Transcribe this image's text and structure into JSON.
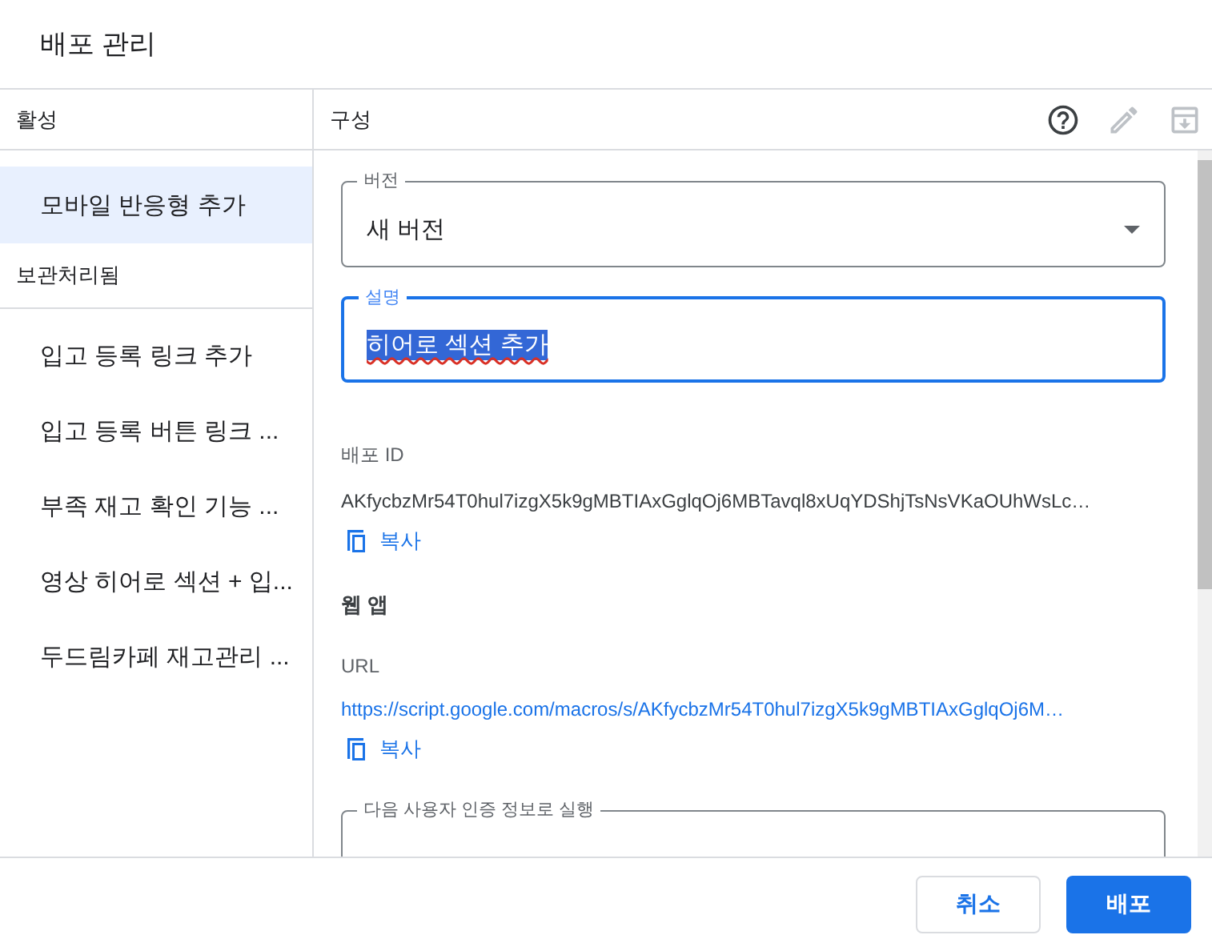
{
  "dialog": {
    "title": "배포 관리"
  },
  "sidebar": {
    "sections": [
      {
        "heading": "활성",
        "items": [
          {
            "label": "모바일 반응형 추가",
            "selected": true
          }
        ]
      },
      {
        "heading": "보관처리됨",
        "items": [
          {
            "label": "입고 등록 링크 추가",
            "selected": false
          },
          {
            "label": "입고 등록 버튼 링크 ...",
            "selected": false
          },
          {
            "label": "부족 재고 확인 기능 ...",
            "selected": false
          },
          {
            "label": "영상 히어로 섹션 + 입...",
            "selected": false
          },
          {
            "label": "두드림카페 재고관리 ...",
            "selected": false
          }
        ]
      }
    ]
  },
  "panel": {
    "title": "구성",
    "toolbar": [
      {
        "kind": "help",
        "disabled": false
      },
      {
        "kind": "edit",
        "disabled": true
      },
      {
        "kind": "archive",
        "disabled": true
      }
    ],
    "fields": [
      {
        "kind": "select",
        "label": "버전",
        "value": "새 버전",
        "focused": false,
        "text_selected": false
      },
      {
        "kind": "text",
        "label": "설명",
        "value": "히어로 섹션 추가",
        "focused": true,
        "text_selected": true
      }
    ],
    "deployment_id": {
      "label": "배포 ID",
      "value": "AKfycbzMr54T0hul7izgX5k9gMBTIAxGglqOj6MBTavql8xUqYDShjTsNsVKaOUhWsLc…",
      "copy": "복사"
    },
    "web_app": {
      "heading": "웹 앱",
      "url_label": "URL",
      "url": "https://script.google.com/macros/s/AKfycbzMr54T0hul7izgX5k9gMBTIAxGglqOj6M…",
      "copy": "복사",
      "run_as": {
        "label": "다음 사용자 인증 정보로 실행"
      }
    }
  },
  "buttons": [
    {
      "label": "취소",
      "kind": "secondary"
    },
    {
      "label": "배포",
      "kind": "primary"
    }
  ]
}
